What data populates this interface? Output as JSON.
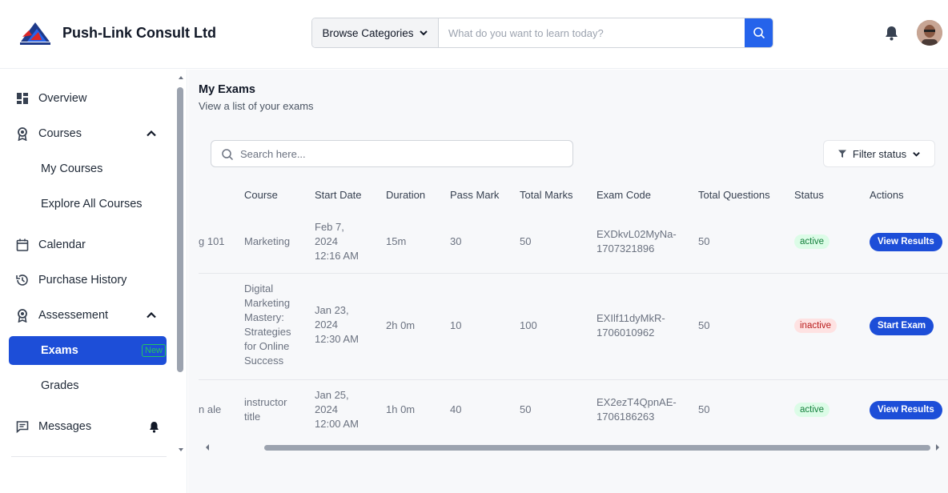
{
  "header": {
    "brand": "Push-Link Consult Ltd",
    "browse_label": "Browse Categories",
    "search_placeholder": "What do you want to learn today?",
    "accent": "#2563eb"
  },
  "sidebar": {
    "overview": "Overview",
    "courses": "Courses",
    "my_courses": "My Courses",
    "explore_courses": "Explore All Courses",
    "calendar": "Calendar",
    "purchase_history": "Purchase History",
    "assessment": "Assessement",
    "exams": "Exams",
    "exams_badge": "New",
    "grades": "Grades",
    "messages": "Messages"
  },
  "main": {
    "title": "My Exams",
    "subtitle": "View a list of your exams",
    "search_placeholder": "Search here...",
    "filter_label": "Filter status",
    "columns": [
      "Course",
      "Start Date",
      "Duration",
      "Pass Mark",
      "Total Marks",
      "Exam Code",
      "Total Questions",
      "Status",
      "Actions"
    ],
    "rows": [
      {
        "name_fragment": "g 101",
        "course": [
          "Marketing"
        ],
        "start_date": [
          "Feb 7,",
          "2024",
          "12:16 AM"
        ],
        "duration": "15m",
        "pass_mark": "30",
        "total_marks": "50",
        "exam_code": [
          "EXDkvL02MyNa-",
          "1707321896"
        ],
        "total_questions": "50",
        "status": "active",
        "action": "View Results"
      },
      {
        "name_fragment": "",
        "course": [
          "Digital",
          "Marketing",
          "Mastery:",
          "Strategies",
          "for Online",
          "Success"
        ],
        "start_date": [
          "Jan 23,",
          "2024",
          "12:30 AM"
        ],
        "duration": "2h 0m",
        "pass_mark": "10",
        "total_marks": "100",
        "exam_code": [
          "EXIlf11dyMkR-",
          "1706010962"
        ],
        "total_questions": "50",
        "status": "inactive",
        "action": "Start Exam"
      },
      {
        "name_fragment": "n ale",
        "course": [
          "instructor",
          "title"
        ],
        "start_date": [
          "Jan 25,",
          "2024",
          "12:00 AM"
        ],
        "duration": "1h 0m",
        "pass_mark": "40",
        "total_marks": "50",
        "exam_code": [
          "EX2ezT4QpnAE-",
          "1706186263"
        ],
        "total_questions": "50",
        "status": "active",
        "action": "View Results"
      }
    ]
  }
}
